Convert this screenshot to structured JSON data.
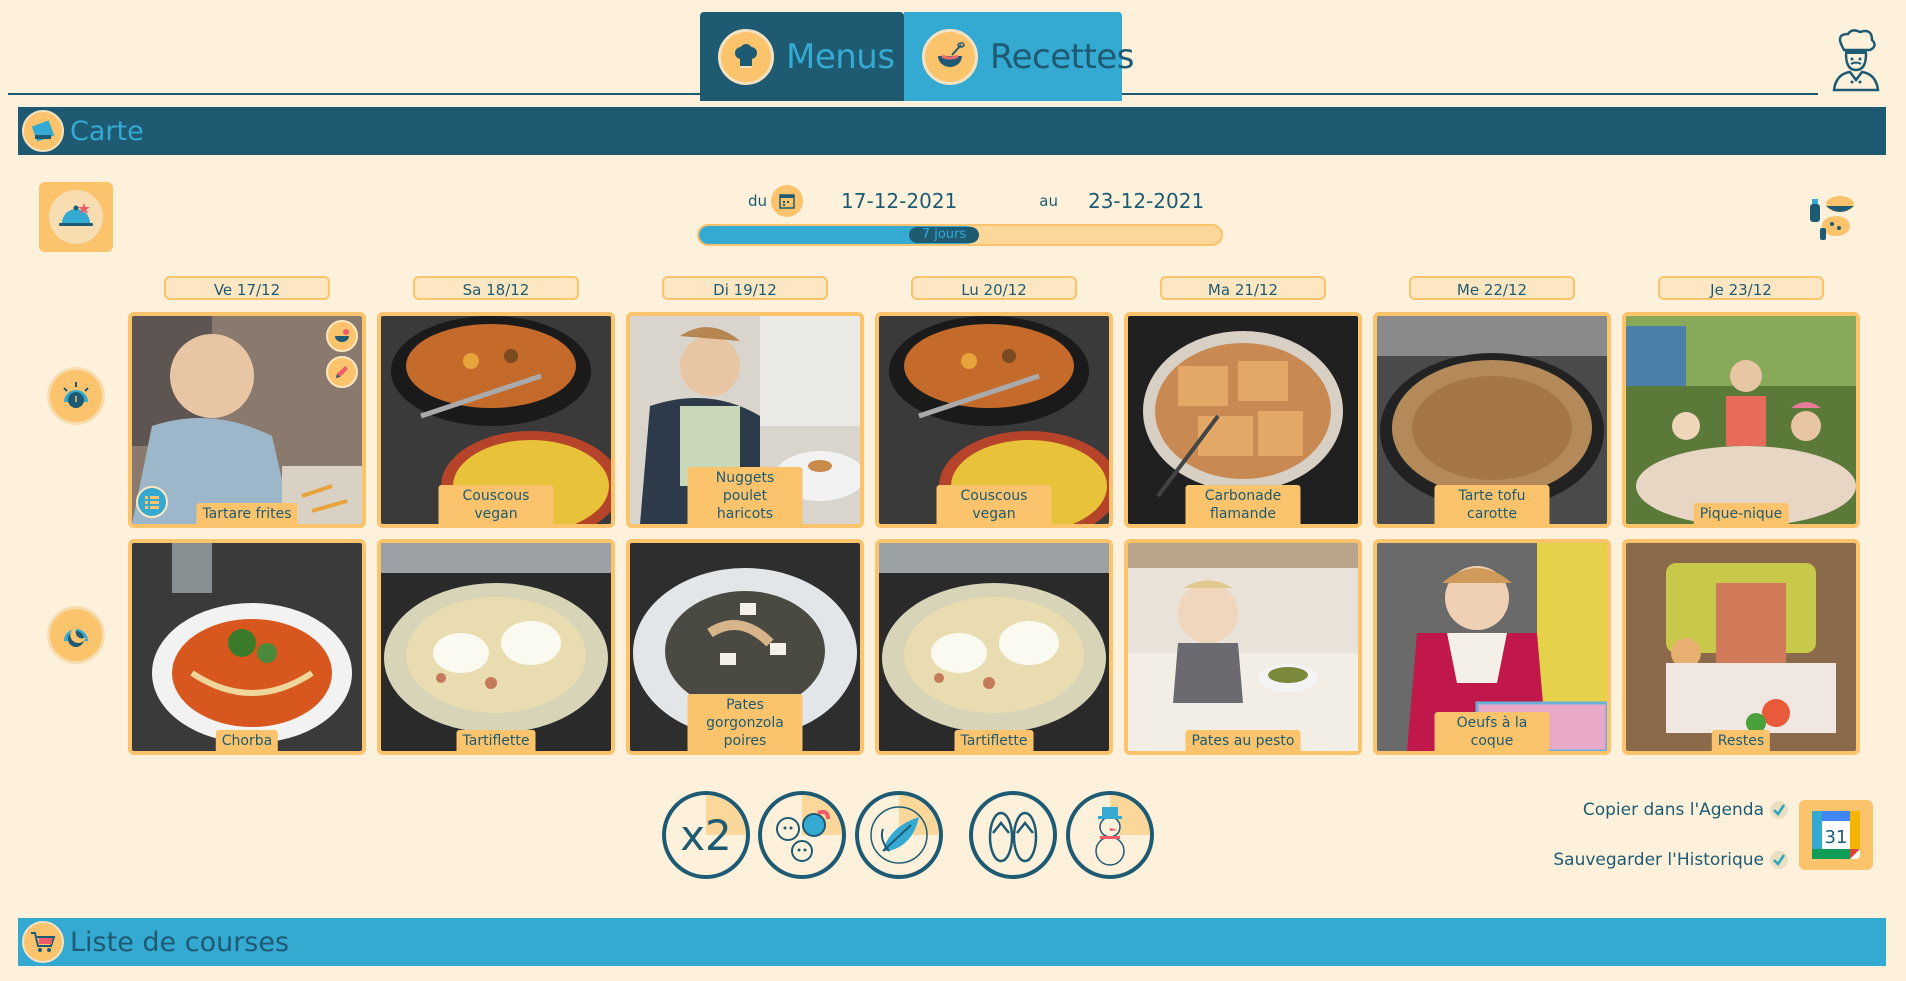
{
  "header": {
    "tabs": [
      {
        "label": "Menus",
        "icon": "chef-hat-icon"
      },
      {
        "label": "Recettes",
        "icon": "mixing-bowl-icon"
      }
    ],
    "profile_icon": "chef-avatar-icon"
  },
  "carte": {
    "title": "Carte",
    "date_from_label": "du",
    "date_from": "17-12-2021",
    "date_to_label": "au",
    "date_to": "23-12-2021",
    "duration_label": "7 jours",
    "duration_fraction": 0.53
  },
  "days": [
    "Ve 17/12",
    "Sa 18/12",
    "Di 19/12",
    "Lu 20/12",
    "Ma 21/12",
    "Me 22/12",
    "Je 23/12"
  ],
  "meals": [
    {
      "name": "midi",
      "icon": "sun-icon",
      "dishes": [
        "Tartare frites",
        "Couscous vegan",
        "Nuggets poulet haricots",
        "Couscous vegan",
        "Carbonade flamande",
        "Tarte tofu carotte",
        "Pique-nique"
      ]
    },
    {
      "name": "soir",
      "icon": "moon-icon",
      "dishes": [
        "Chorba",
        "Tartiflette",
        "Pates gorgonzola poires",
        "Tartiflette",
        "Pates au pesto",
        "Oeufs à la coque",
        "Restes"
      ]
    }
  ],
  "options": [
    {
      "icon": "x2-portions-icon",
      "text": "x2"
    },
    {
      "icon": "family-icon"
    },
    {
      "icon": "vegan-friendly-icon"
    },
    {
      "icon": "flip-flops-summer-icon"
    },
    {
      "icon": "snowman-winter-icon"
    }
  ],
  "actions": {
    "copy_agenda": "Copier dans l'Agenda",
    "save_history": "Sauvegarder l'Historique",
    "calendar_day": "31"
  },
  "courses": {
    "title": "Liste de courses"
  },
  "colors": {
    "background": "#fdf1dc",
    "dark_teal": "#1e5b73",
    "blue": "#34a9d2",
    "orange": "#fbc36b"
  }
}
